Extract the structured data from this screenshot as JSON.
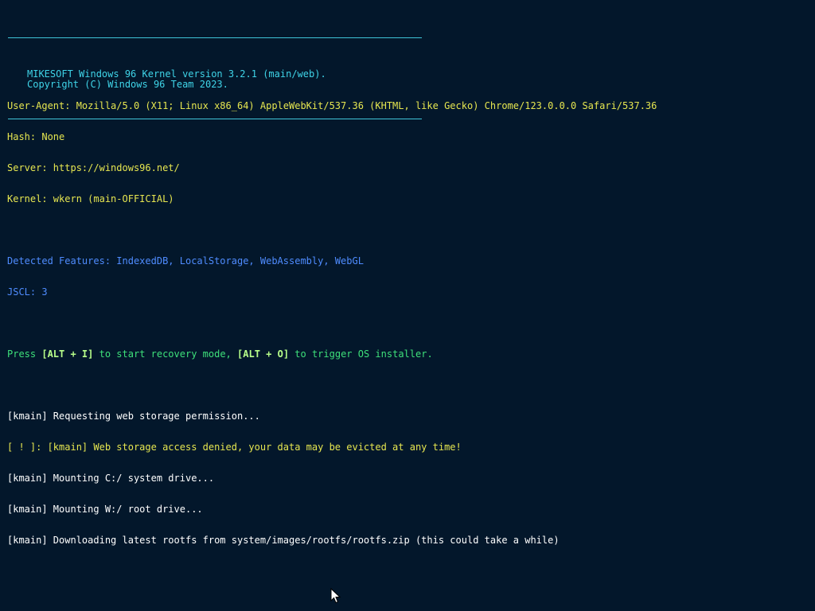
{
  "banner": {
    "line1": "MIKESOFT Windows 96 Kernel version 3.2.1 (main/web).",
    "line2": "Copyright (C) Windows 96 Team 2023."
  },
  "env": {
    "user_agent": "User-Agent: Mozilla/5.0 (X11; Linux x86_64) AppleWebKit/537.36 (KHTML, like Gecko) Chrome/123.0.0.0 Safari/537.36",
    "hash": "Hash: None",
    "server": "Server: https://windows96.net/",
    "kernel": "Kernel: wkern (main-OFFICIAL)"
  },
  "features": {
    "detected": "Detected Features: IndexedDB, LocalStorage, WebAssembly, WebGL",
    "jscl": "JSCL: 3"
  },
  "prompt": {
    "press": "Press ",
    "key1": "[ALT + I]",
    "mid": " to start recovery mode, ",
    "key2": "[ALT + O]",
    "end": " to trigger OS installer."
  },
  "log": {
    "l1": "[kmain] Requesting web storage permission...",
    "l2": "[ ! ]: [kmain] Web storage access denied, your data may be evicted at any time!",
    "l3": "[kmain] Mounting C:/ system drive...",
    "l4": "[kmain] Mounting W:/ root drive...",
    "l5": "[kmain] Downloading latest rootfs from system/images/rootfs/rootfs.zip (this could take a while)"
  },
  "icons": {
    "cursor": "mouse-pointer-icon"
  },
  "colors": {
    "background": "#03172b",
    "banner": "#3fd4e8",
    "info": "#e6e650",
    "features": "#4f8cff",
    "prompt": "#3ee07a",
    "log": "#ffffff"
  }
}
